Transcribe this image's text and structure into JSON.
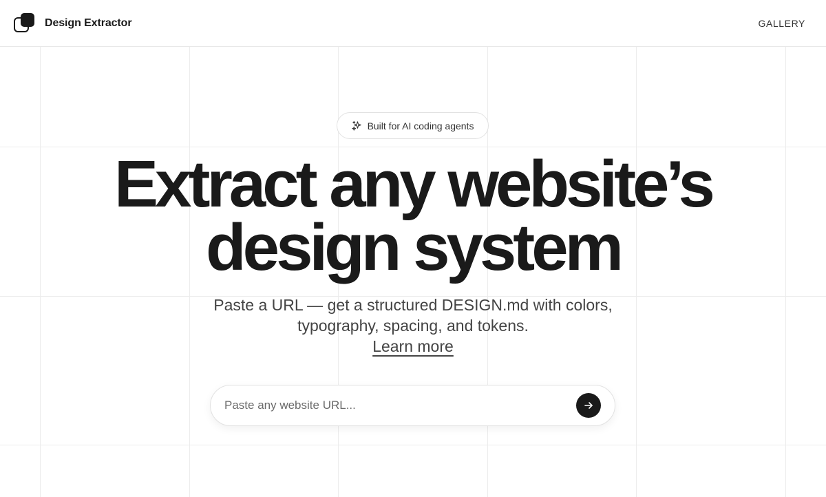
{
  "header": {
    "brand_name": "Design Extractor",
    "nav_gallery": "GALLERY"
  },
  "hero": {
    "badge_text": "Built for AI coding agents",
    "badge_icon": "sparkles-icon",
    "headline_line1": "Extract any website’s",
    "headline_line2": "design system",
    "subhead_line1": "Paste a URL — get a structured DESIGN.md with colors,",
    "subhead_line2_prefix": "typography, spacing, and tokens.",
    "learn_more": "Learn more"
  },
  "search": {
    "placeholder": "Paste any website URL...",
    "value": "",
    "submit_icon": "arrow-right-icon"
  },
  "colors": {
    "text_primary": "#1a1a1a",
    "text_secondary": "#444444",
    "border": "#e2e2e2",
    "grid_line": "#ececec",
    "button_bg": "#1a1a1a"
  }
}
